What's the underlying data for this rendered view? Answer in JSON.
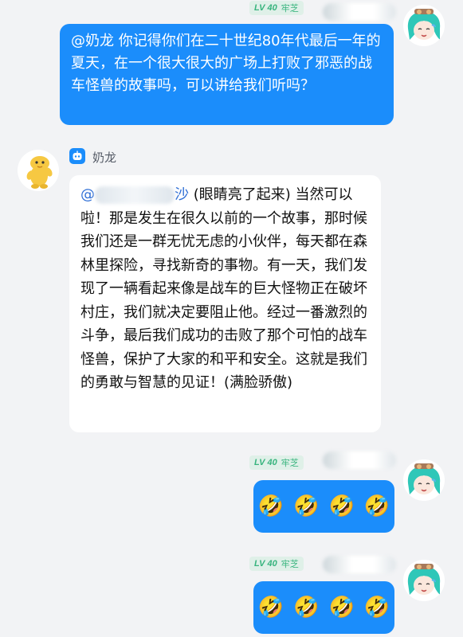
{
  "messages": {
    "top": {
      "level": "LV 40",
      "title": "牢芝",
      "text": "@奶龙 你记得你们在二十世纪80年代最后一年的夏天，在一个很大很大的广场上打败了邪恶的战车怪兽的故事吗，可以讲给我们听吗？"
    },
    "bot": {
      "name": "奶龙",
      "mention_prefix": "@",
      "mention_suffix": "沙",
      "text": " (眼睛亮了起来) 当然可以啦！那是发生在很久以前的一个故事，那时候我们还是一群无忧无虑的小伙伴，每天都在森林里探险，寻找新奇的事物。有一天，我们发现了一辆看起来像是战车的巨大怪物正在破坏村庄，我们就决定要阻止他。经过一番激烈的斗争，最后我们成功的击败了那个可怕的战车怪兽，保护了大家的和平和安全。这就是我们的勇敢与智慧的见证！(满脸骄傲)"
    },
    "reply1": {
      "level": "LV 40",
      "title": "牢芝",
      "emojis": [
        "🤣",
        "🤣",
        "🤣",
        "🤣"
      ]
    },
    "reply2": {
      "level": "LV 40",
      "title": "牢芝",
      "emojis": [
        "🤣",
        "🤣",
        "🤣",
        "🤣"
      ]
    }
  },
  "colors": {
    "bubble_self": "#1b8dfb",
    "bubble_other": "#ffffff",
    "level_badge": "#38b47e",
    "background": "#f2f3f5"
  }
}
